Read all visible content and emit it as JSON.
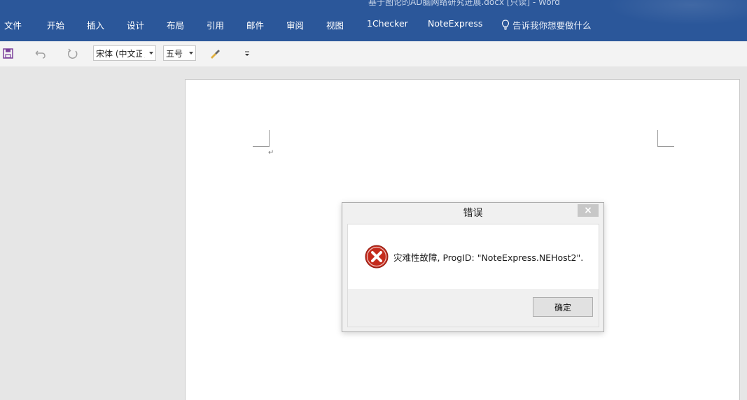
{
  "window": {
    "title": "基于图论的AD脑网络研究进展.docx [只读]  -  Word"
  },
  "ribbon": {
    "tabs": [
      {
        "label": "文件"
      },
      {
        "label": "开始"
      },
      {
        "label": "插入"
      },
      {
        "label": "设计"
      },
      {
        "label": "布局"
      },
      {
        "label": "引用"
      },
      {
        "label": "邮件"
      },
      {
        "label": "审阅"
      },
      {
        "label": "视图"
      },
      {
        "label": "1Checker"
      },
      {
        "label": "NoteExpress"
      }
    ],
    "tell_me": "告诉我你想要做什么",
    "tell_me_icon": "lightbulb-icon",
    "accent_color": "#2b579a"
  },
  "qat": {
    "save_icon": "save-icon",
    "undo_icon": "undo-icon",
    "redo_icon": "redo-icon",
    "font_name": "宋体 (中文正文",
    "font_size": "五号",
    "format_painter_icon": "format-painter-icon",
    "customize_icon": "customize-qat-icon"
  },
  "document": {
    "paragraph_mark": "↵"
  },
  "dialog": {
    "title": "错误",
    "close_label": "×",
    "icon": "error-icon",
    "message": "灾难性故障, ProgID: \"NoteExpress.NEHost2\".",
    "ok_label": "确定",
    "error_color": "#c42b1c"
  }
}
